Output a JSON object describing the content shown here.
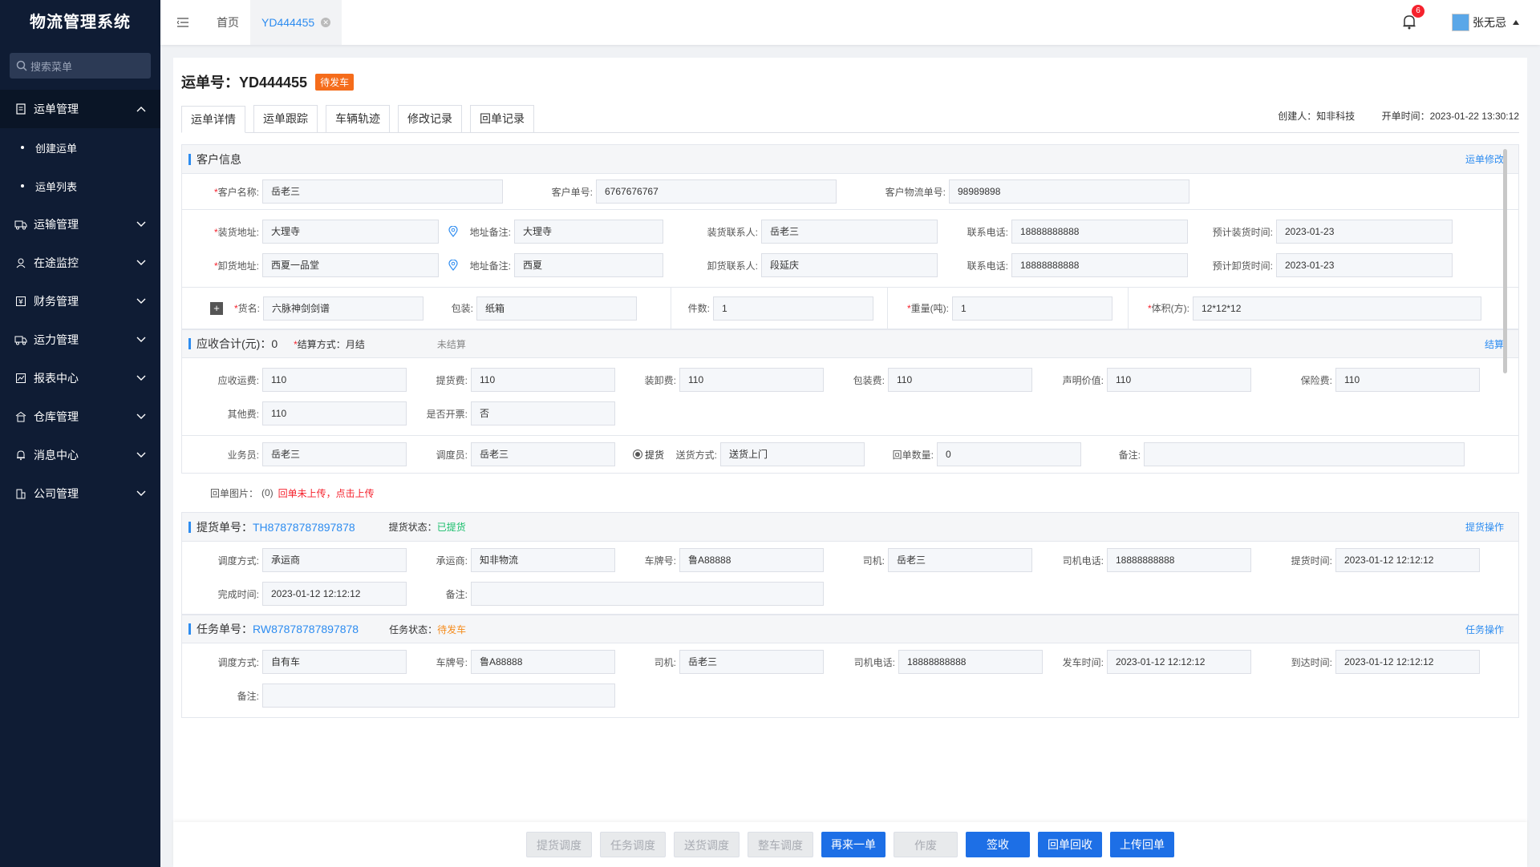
{
  "app": {
    "title": "物流管理系统",
    "search_placeholder": "搜索菜单"
  },
  "sidebar": {
    "items": [
      {
        "label": "运单管理",
        "icon": "document-icon",
        "open": true
      },
      {
        "label": "运输管理",
        "icon": "truck-icon"
      },
      {
        "label": "在途监控",
        "icon": "monitor-icon"
      },
      {
        "label": "财务管理",
        "icon": "finance-icon"
      },
      {
        "label": "运力管理",
        "icon": "capacity-icon"
      },
      {
        "label": "报表中心",
        "icon": "chart-icon"
      },
      {
        "label": "仓库管理",
        "icon": "warehouse-icon"
      },
      {
        "label": "消息中心",
        "icon": "bell-icon"
      },
      {
        "label": "公司管理",
        "icon": "company-icon"
      }
    ],
    "sub_items": [
      "创建运单",
      "运单列表"
    ]
  },
  "header": {
    "tabs": [
      {
        "label": "首页"
      },
      {
        "label": "YD444455"
      }
    ],
    "notification_count": "6",
    "user_name": "张无忌"
  },
  "page": {
    "title": "运单号：YD444455",
    "status": "待发车",
    "tabs": [
      "运单详情",
      "运单跟踪",
      "车辆轨迹",
      "修改记录",
      "回单记录"
    ],
    "creator": "创建人：知非科技",
    "open_time": "开单时间：2023-01-22   13:30:12"
  },
  "customer": {
    "head": "客户信息",
    "action": "运单修改",
    "name_label": "客户名称:",
    "name": "岳老三",
    "order_no_label": "客户单号:",
    "order_no": "6767676767",
    "logistics_no_label": "客户物流单号:",
    "logistics_no": "98989898",
    "load_addr_label": "装货地址:",
    "load_addr": "大理寺",
    "addr_note_label": "地址备注:",
    "load_addr_note": "大理寺",
    "load_contact_label": "装货联系人:",
    "load_contact": "岳老三",
    "phone_label": "联系电话:",
    "load_phone": "18888888888",
    "load_time_label": "预计装货时间:",
    "load_time": "2023-01-23",
    "unload_addr_label": "卸货地址:",
    "unload_addr": "西夏一品堂",
    "unload_addr_note": "西夏",
    "unload_contact_label": "卸货联系人:",
    "unload_contact": "段延庆",
    "unload_phone": "18888888888",
    "unload_time_label": "预计卸货时间:",
    "unload_time": "2023-01-23",
    "goods_label": "货名:",
    "goods": "六脉神剑剑谱",
    "pack_label": "包装:",
    "pack": "纸箱",
    "count_label": "件数:",
    "count": "1",
    "weight_label": "重量(吨):",
    "weight": "1",
    "volume_label": "体积(方):",
    "volume": "12*12*12"
  },
  "finance": {
    "head": "应收合计(元)：0",
    "settle_label": "结算方式：",
    "settle": "月结",
    "settle_status": "未结算",
    "action": "结算",
    "freight_label": "应收运费:",
    "freight": "110",
    "pickup_fee_label": "提货费:",
    "pickup_fee": "110",
    "handling_label": "装卸费:",
    "handling": "110",
    "pack_fee_label": "包装费:",
    "pack_fee": "110",
    "declared_label": "声明价值:",
    "declared": "110",
    "insurance_label": "保险费:",
    "insurance": "110",
    "other_label": "其他费:",
    "other": "110",
    "invoice_label": "是否开票:",
    "invoice": "否",
    "sales_label": "业务员:",
    "sales": "岳老三",
    "dispatcher_label": "调度员:",
    "dispatcher": "岳老三",
    "pickup_radio": "提货",
    "delivery_label": "送货方式:",
    "delivery": "送货上门",
    "receipt_qty_label": "回单数量:",
    "receipt_qty": "0",
    "remark_label": "备注:",
    "remark": "",
    "receipt_img_label": "回单图片：",
    "receipt_img_count": "(0)",
    "receipt_upload": "回单未上传，点击上传"
  },
  "pickup": {
    "head": "提货单号：",
    "no": "TH87878787897878",
    "status_label": "提货状态：",
    "status": "已提货",
    "action": "提货操作",
    "mode_label": "调度方式:",
    "mode": "承运商",
    "carrier_label": "承运商:",
    "carrier": "知非物流",
    "plate_label": "车牌号:",
    "plate": "鲁A88888",
    "driver_label": "司机:",
    "driver": "岳老三",
    "driver_phone_label": "司机电话:",
    "driver_phone": "18888888888",
    "pickup_time_label": "提货时间:",
    "pickup_time": "2023-01-12 12:12:12",
    "done_time_label": "完成时间:",
    "done_time": "2023-01-12 12:12:12",
    "remark_label": "备注:",
    "remark": ""
  },
  "task": {
    "head": "任务单号：",
    "no": "RW87878787897878",
    "status_label": "任务状态：",
    "status": "待发车",
    "action": "任务操作",
    "mode_label": "调度方式:",
    "mode": "自有车",
    "plate_label": "车牌号:",
    "plate": "鲁A88888",
    "driver_label": "司机:",
    "driver": "岳老三",
    "driver_phone_label": "司机电话:",
    "driver_phone": "18888888888",
    "depart_label": "发车时间:",
    "depart": "2023-01-12 12:12:12",
    "arrive_label": "到达时间:",
    "arrive": "2023-01-12 12:12:12",
    "remark_label": "备注:",
    "remark": ""
  },
  "footer": {
    "buttons": [
      "提货调度",
      "任务调度",
      "送货调度",
      "整车调度",
      "再来一单",
      "作废",
      "签收",
      "回单回收",
      "上传回单"
    ]
  }
}
